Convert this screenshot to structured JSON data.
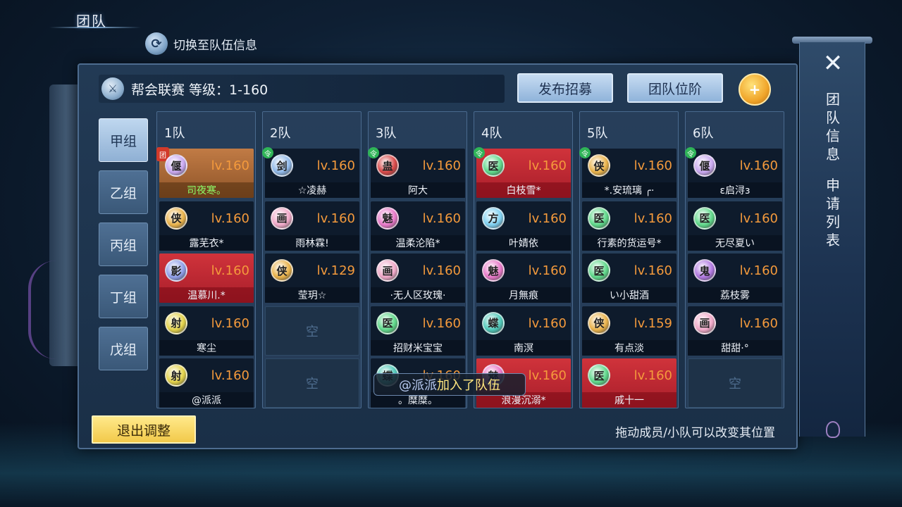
{
  "header": {
    "title": "团队",
    "switch_label": "切换至队伍信息"
  },
  "panel": {
    "league_label": "帮会联赛  等级：1-160",
    "recruit_button": "发布招募",
    "rank_button": "团队位阶",
    "add_icon": "add-member-icon",
    "exit_button": "退出调整",
    "hint": "拖动成员/小队可以改变其位置"
  },
  "groups": [
    "甲组",
    "乙组",
    "丙组",
    "丁组",
    "戊组"
  ],
  "active_group": "甲组",
  "empty_label": "空",
  "teams": [
    {
      "title": "1队",
      "members": [
        {
          "name": "司夜寒。",
          "level": "lv.160",
          "icon": "偃",
          "highlight": "orange",
          "badge": "团"
        },
        {
          "name": "露芜衣*",
          "level": "lv.160",
          "icon": "侠"
        },
        {
          "name": "温慕川.*",
          "level": "lv.160",
          "icon": "影",
          "highlight": "red"
        },
        {
          "name": "寒尘",
          "level": "lv.160",
          "icon": "射"
        },
        {
          "name": "@派派",
          "level": "lv.160",
          "icon": "射"
        }
      ]
    },
    {
      "title": "2队",
      "members": [
        {
          "name": "☆凌赫",
          "level": "lv.160",
          "icon": "剑",
          "badge": "令"
        },
        {
          "name": "雨林霖!",
          "level": "lv.160",
          "icon": "画"
        },
        {
          "name": "莹玥☆",
          "level": "lv.129",
          "icon": "侠"
        }
      ]
    },
    {
      "title": "3队",
      "members": [
        {
          "name": "阿大",
          "level": "lv.160",
          "icon": "蛊",
          "badge": "令"
        },
        {
          "name": "温柔沦陷*",
          "level": "lv.160",
          "icon": "魅"
        },
        {
          "name": "·无人区玫瑰·",
          "level": "lv.160",
          "icon": "画"
        },
        {
          "name": "招财米宝宝",
          "level": "lv.160",
          "icon": "医"
        },
        {
          "name": "。糜糜。",
          "level": "lv.160",
          "icon": "蝶"
        }
      ]
    },
    {
      "title": "4队",
      "members": [
        {
          "name": "白枝雪*",
          "level": "lv.160",
          "icon": "医",
          "highlight": "red",
          "badge": "令"
        },
        {
          "name": "叶婧依",
          "level": "lv.160",
          "icon": "方"
        },
        {
          "name": "月無痕",
          "level": "lv.160",
          "icon": "魅"
        },
        {
          "name": "南溟",
          "level": "lv.160",
          "icon": "蝶"
        },
        {
          "name": "浪漫沉溺*",
          "level": "lv.160",
          "icon": "魅",
          "highlight": "red"
        }
      ]
    },
    {
      "title": "5队",
      "members": [
        {
          "name": "*.安琉璃 ╭·",
          "level": "lv.160",
          "icon": "侠",
          "badge": "令"
        },
        {
          "name": "行素的货运号*",
          "level": "lv.160",
          "icon": "医"
        },
        {
          "name": "い小甜酒",
          "level": "lv.160",
          "icon": "医"
        },
        {
          "name": "有点淡",
          "level": "lv.159",
          "icon": "侠"
        },
        {
          "name": "戚十一",
          "level": "lv.160",
          "icon": "医",
          "highlight": "red"
        }
      ]
    },
    {
      "title": "6队",
      "members": [
        {
          "name": "ε启浔з",
          "level": "lv.160",
          "icon": "偃",
          "badge": "令"
        },
        {
          "name": "无尽夏い",
          "level": "lv.160",
          "icon": "医"
        },
        {
          "name": "荔枝雾",
          "level": "lv.160",
          "icon": "鬼"
        },
        {
          "name": "甜甜·°",
          "level": "lv.160",
          "icon": "画"
        }
      ]
    }
  ],
  "toast": {
    "who": "@派派",
    "what": "加入了队伍"
  },
  "side_panel": {
    "close_icon": "close-icon",
    "tab1": "团队信息",
    "tab2": "申请列表"
  },
  "class_colors": {
    "偃": "#c9a8f0",
    "侠": "#e9b24a",
    "影": "#8f9ee8",
    "射": "#e3d24a",
    "剑": "#8fb8e8",
    "画": "#f0a8c8",
    "蛊": "#d84848",
    "魅": "#e878c8",
    "医": "#5fd88a",
    "蝶": "#4fc8b8",
    "方": "#7fd0f0",
    "鬼": "#b078e0"
  }
}
